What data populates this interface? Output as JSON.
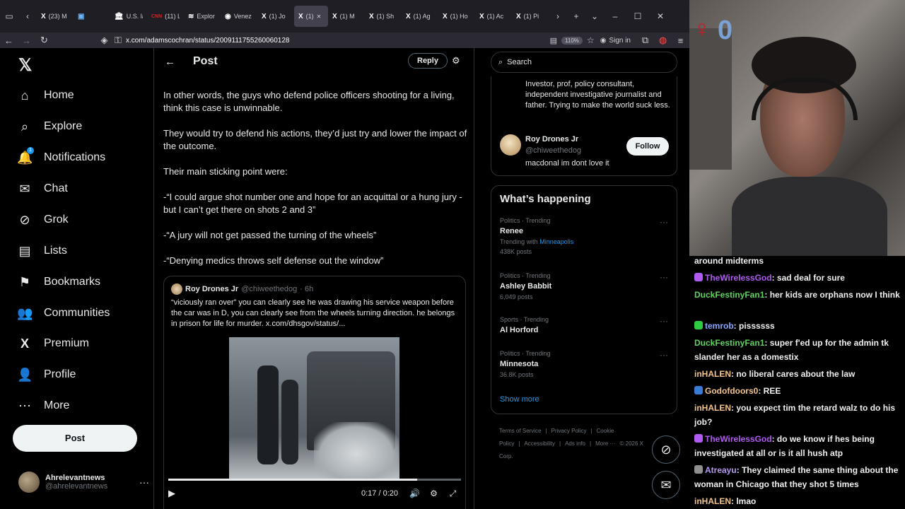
{
  "browser": {
    "tabs": [
      {
        "icon": "X",
        "label": "(23) M"
      },
      {
        "icon": "▣",
        "label": ""
      },
      {
        "icon": "🏛",
        "label": "U.S. la"
      },
      {
        "icon": "CNN",
        "label": "(11) Li"
      },
      {
        "icon": "≋",
        "label": "Explor"
      },
      {
        "icon": "◉",
        "label": "Venez"
      },
      {
        "icon": "X",
        "label": "(1) Jo"
      },
      {
        "icon": "X",
        "label": "(1)"
      },
      {
        "icon": "X",
        "label": "(1) M"
      },
      {
        "icon": "X",
        "label": "(1) Sh"
      },
      {
        "icon": "X",
        "label": "(1) Ag"
      },
      {
        "icon": "X",
        "label": "(1) Ho"
      },
      {
        "icon": "X",
        "label": "(1) Ac"
      },
      {
        "icon": "X",
        "label": "(1) Pi"
      }
    ],
    "active_tab": 7,
    "url": "x.com/adamscochran/status/2009111755260060128",
    "zoom": "110%",
    "sign_in": "Sign in"
  },
  "leftnav": {
    "items": [
      {
        "label": "Home",
        "icon": "home-icon",
        "glyph": "⌂"
      },
      {
        "label": "Explore",
        "icon": "search-icon",
        "glyph": "⌕"
      },
      {
        "label": "Notifications",
        "icon": "bell-icon",
        "glyph": "🔔"
      },
      {
        "label": "Chat",
        "icon": "mail-icon",
        "glyph": "✉"
      },
      {
        "label": "Grok",
        "icon": "grok-icon",
        "glyph": "⊘"
      },
      {
        "label": "Lists",
        "icon": "list-icon",
        "glyph": "▤"
      },
      {
        "label": "Bookmarks",
        "icon": "bookmark-icon",
        "glyph": "⚑"
      },
      {
        "label": "Communities",
        "icon": "people-icon",
        "glyph": "👥"
      },
      {
        "label": "Premium",
        "icon": "x-icon",
        "glyph": "X"
      },
      {
        "label": "Profile",
        "icon": "person-icon",
        "glyph": "👤"
      },
      {
        "label": "More",
        "icon": "more-icon",
        "glyph": "⋯"
      }
    ],
    "notification_badge": "1",
    "post_button": "Post",
    "account": {
      "name": "Ahrelevantnews",
      "handle": "@ahrelevantnews"
    }
  },
  "main": {
    "title": "Post",
    "reply": "Reply",
    "paragraphs": [
      "In other words, the guys who defend police officers shooting for a living, think this case is unwinnable.",
      "They would try to defend his actions, they’d just try and lower the impact of the outcome.",
      "Their main sticking point were:",
      "-“I could argue shot number one and hope for an acquittal or a hung jury - but I can’t get there on shots 2 and 3”",
      "-“A jury will not get passed the turning of the wheels”",
      "-“Denying medics throws self defense out the window”"
    ],
    "quote": {
      "name": "Roy Drones Jr",
      "handle": "@chiweethedog",
      "time": "· 6h",
      "text": "“viciously ran over” you can clearly see he was drawing his service weapon before the car was in D, you can clearly see from the wheels turning direction. he belongs in prison for life for murder.  x.com/dhsgov/status/..."
    },
    "video": {
      "time": "0:17 / 0:20",
      "progress": 0.85
    }
  },
  "right": {
    "search_placeholder": "Search",
    "who": {
      "bio_top": "Investor, prof, policy consultant, independent investigative journalist and father. Trying to make the world suck less.",
      "name": "Roy Drones Jr",
      "handle": "@chiweethedog",
      "bio": "macdonal im dont love it",
      "follow": "Follow"
    },
    "whats_happening": "What’s happening",
    "trends": [
      {
        "meta": "Politics · Trending",
        "name": "Renee",
        "sub_prefix": "Trending with",
        "sub_link": "Minneapolis",
        "count": "438K posts"
      },
      {
        "meta": "Politics · Trending",
        "name": "Ashley Babbit",
        "count": "6,049 posts"
      },
      {
        "meta": "Sports · Trending",
        "name": "Al Horford",
        "count": ""
      },
      {
        "meta": "Politics · Trending",
        "name": "Minnesota",
        "count": "36.8K posts"
      }
    ],
    "show_more": "Show more",
    "footer": [
      "Terms of Service",
      "|",
      "Privacy Policy",
      "|",
      "Cookie Policy",
      "|",
      "Accessibility",
      "|",
      "Ads info",
      "|",
      "More ···",
      "© 2026 X Corp."
    ]
  },
  "stream": {
    "chat": [
      {
        "user": "",
        "text": "around midterms",
        "color": "#efeff1"
      },
      {
        "user": "TheWirelessGod",
        "text": ": sad deal for sure",
        "color": "#b05cf2",
        "badge": "#b05cf2"
      },
      {
        "user": "DuckFestinyFan1",
        "text": ": her kids are orphans now I think",
        "color": "#5fd35f"
      },
      {
        "user": "temrob",
        "text": ": pissssss",
        "color": "#8aa6ff",
        "badge": "#2ecc40"
      },
      {
        "user": "DuckFestinyFan1",
        "text": ": super f'ed up for the admin tk slander her as a domestix",
        "color": "#5fd35f"
      },
      {
        "user": "inHALEN",
        "text": ": no liberal cares about the law",
        "color": "#f2c48d"
      },
      {
        "user": "Godofdoors0",
        "text": ": REE",
        "color": "#f2c48d",
        "badge": "#3a7bd5"
      },
      {
        "user": "inHALEN",
        "text": ": you expect tim the retard walz to do his job?",
        "color": "#f2c48d"
      },
      {
        "user": "TheWirelessGod",
        "text": ": do we know if hes being investigated at all or is it all hush atp",
        "color": "#b05cf2",
        "badge": "#b05cf2"
      },
      {
        "user": "Atreayu",
        "text": ": They claimed the same thing about the woman in Chicago that they shot 5 times",
        "color": "#b79af2",
        "badge": "#8f8f8f"
      },
      {
        "user": "inHALEN",
        "text": ": lmao",
        "color": "#f2c48d"
      }
    ]
  }
}
